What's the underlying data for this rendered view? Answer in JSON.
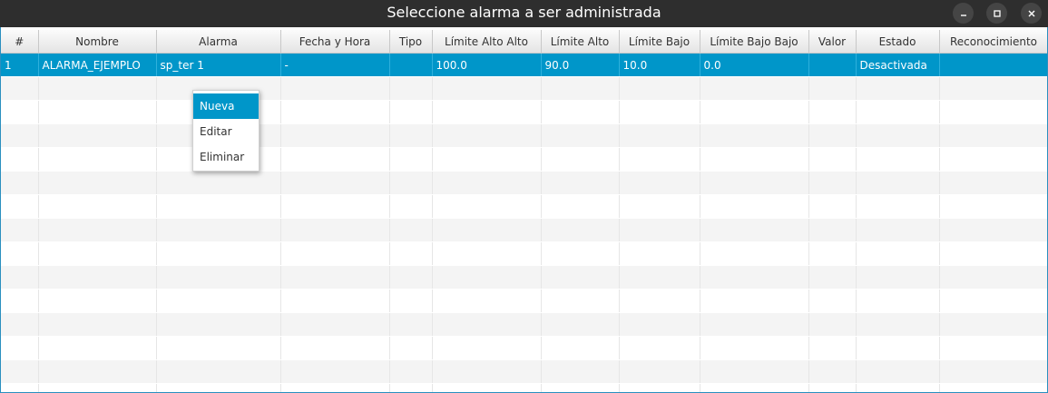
{
  "window": {
    "title": "Seleccione alarma a ser administrada",
    "buttons": [
      "minimize-icon",
      "maximize-icon",
      "close-icon"
    ]
  },
  "table": {
    "columns": [
      "#",
      "Nombre",
      "Alarma",
      "Fecha y Hora",
      "Tipo",
      "Límite Alto Alto",
      "Límite Alto",
      "Límite Bajo",
      "Límite Bajo Bajo",
      "Valor",
      "Estado",
      "Reconocimiento"
    ],
    "rows": [
      [
        "1",
        "ALARMA_EJEMPLO",
        "sp_ter                1",
        "-",
        "",
        "100.0",
        "90.0",
        "10.0",
        "0.0",
        "",
        "Desactivada",
        ""
      ]
    ],
    "selected_row": 0
  },
  "context_menu": {
    "items": [
      "Nueva",
      "Editar",
      "Eliminar"
    ],
    "highlighted": 0
  },
  "colors": {
    "titlebar": "#2e2e2e",
    "selection": "#0096c9",
    "stripe": "#f4f4f4",
    "border": "#2a8fbf"
  }
}
